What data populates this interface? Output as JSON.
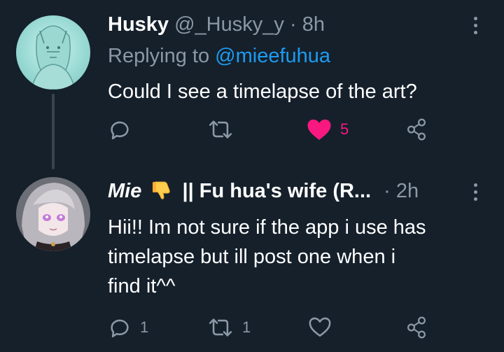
{
  "tweets": [
    {
      "author_name": "Husky",
      "author_handle": "@_Husky_y",
      "dot": "·",
      "time": "8h",
      "reply_prefix": "Replying to",
      "reply_mention": "@mieefuhua",
      "text": "Could I see a timelapse of the art?",
      "actions": {
        "reply_count": "",
        "retweet_count": "",
        "like_count": "5",
        "liked": true
      }
    },
    {
      "author_name_part1": "Mie",
      "author_name_part2": "|| Fu hua's wife (R...",
      "name_emoji": "thumbs-down-emoji",
      "dot": "·",
      "time": "2h",
      "text_line1": "Hii!! Im not sure if the app i use has",
      "text_line2": "timelapse but ill post one when i",
      "text_line3": "find it^^",
      "actions": {
        "reply_count": "1",
        "retweet_count": "1",
        "like_count": "",
        "liked": false
      }
    }
  ],
  "colors": {
    "background": "#15202b",
    "secondary_text": "#8b98a5",
    "link": "#1d9bf0",
    "like": "#f91880",
    "thread_line": "#38444d"
  },
  "icons": [
    "reply-icon",
    "retweet-icon",
    "like-icon",
    "share-icon",
    "more-icon"
  ]
}
